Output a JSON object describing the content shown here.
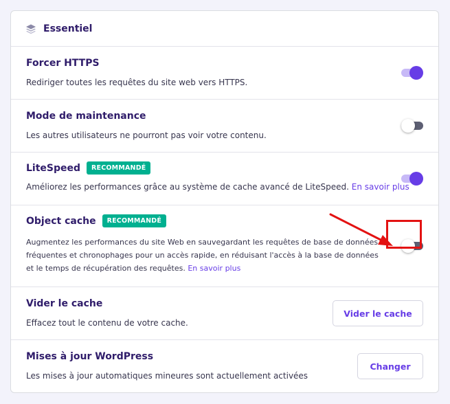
{
  "header": {
    "title": "Essentiel",
    "icon": "layers-icon"
  },
  "settings": {
    "force_https": {
      "title": "Forcer HTTPS",
      "description": "Rediriger toutes les requêtes du site web vers HTTPS.",
      "enabled": true
    },
    "maintenance": {
      "title": "Mode de maintenance",
      "description": "Les autres utilisateurs ne pourront pas voir votre contenu.",
      "enabled": false
    },
    "litespeed": {
      "title": "LiteSpeed",
      "badge": "RECOMMANDÉ",
      "description": "Améliorez les performances grâce au système de cache avancé de LiteSpeed.",
      "link": "En savoir plus",
      "enabled": true
    },
    "object_cache": {
      "title": "Object cache",
      "badge": "RECOMMANDÉ",
      "description": "Augmentez les performances du site Web en sauvegardant les requêtes de base de données fréquentes et chronophages pour un accès rapide, en réduisant l'accès à la base de données et le temps de récupération des requêtes.",
      "link": "En savoir plus",
      "enabled": false
    },
    "clear_cache": {
      "title": "Vider le cache",
      "description": "Effacez tout le contenu de votre cache.",
      "button_label": "Vider le cache"
    },
    "wp_updates": {
      "title": "Mises à jour WordPress",
      "description": "Les mises à jour automatiques mineures sont actuellement activées",
      "button_label": "Changer"
    }
  },
  "colors": {
    "accent": "#673de6",
    "badge": "#00b090",
    "annotation": "#e31212"
  }
}
